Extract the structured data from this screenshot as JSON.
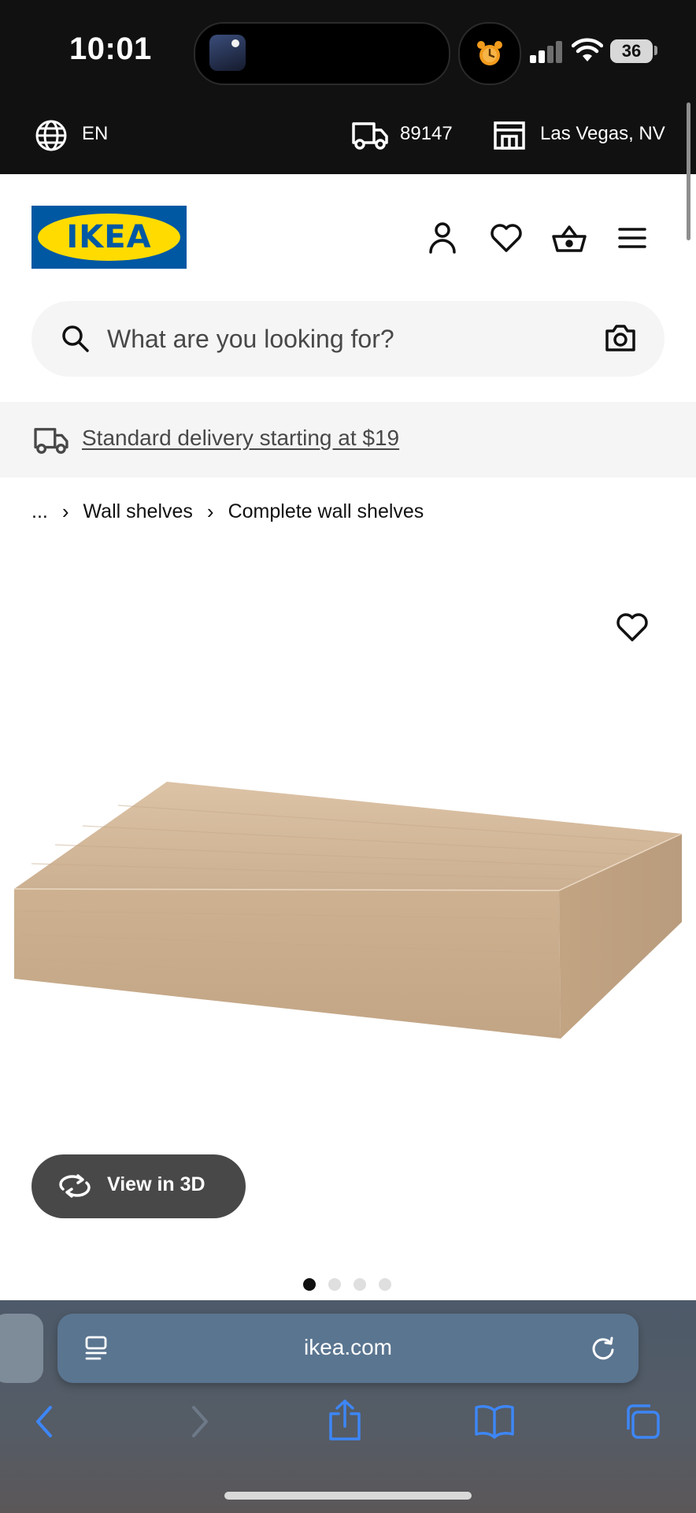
{
  "status_bar": {
    "time": "10:01",
    "battery": "36",
    "live_activity_thumb": "album-art-icon",
    "alarm_icon": "alarm-clock-icon"
  },
  "utility_bar": {
    "language": "EN",
    "zip": "89147",
    "store": "Las Vegas, NV"
  },
  "header": {
    "logo_text": "IKEA",
    "icons": [
      "account-icon",
      "heart-icon",
      "basket-icon",
      "menu-icon"
    ]
  },
  "search": {
    "placeholder": "What are you looking for?"
  },
  "delivery_banner": {
    "text": "Standard delivery starting at $19"
  },
  "breadcrumb": {
    "items": [
      "...",
      "Wall shelves",
      "Complete wall shelves"
    ],
    "separator": "›"
  },
  "product_gallery": {
    "view_3d_label": "View in 3D",
    "image_count": 4,
    "active_index": 0
  },
  "browser": {
    "url": "ikea.com"
  },
  "colors": {
    "ikea_blue": "#0058a3",
    "ikea_yellow": "#ffdb00",
    "safari_accent": "#3d86f6"
  }
}
